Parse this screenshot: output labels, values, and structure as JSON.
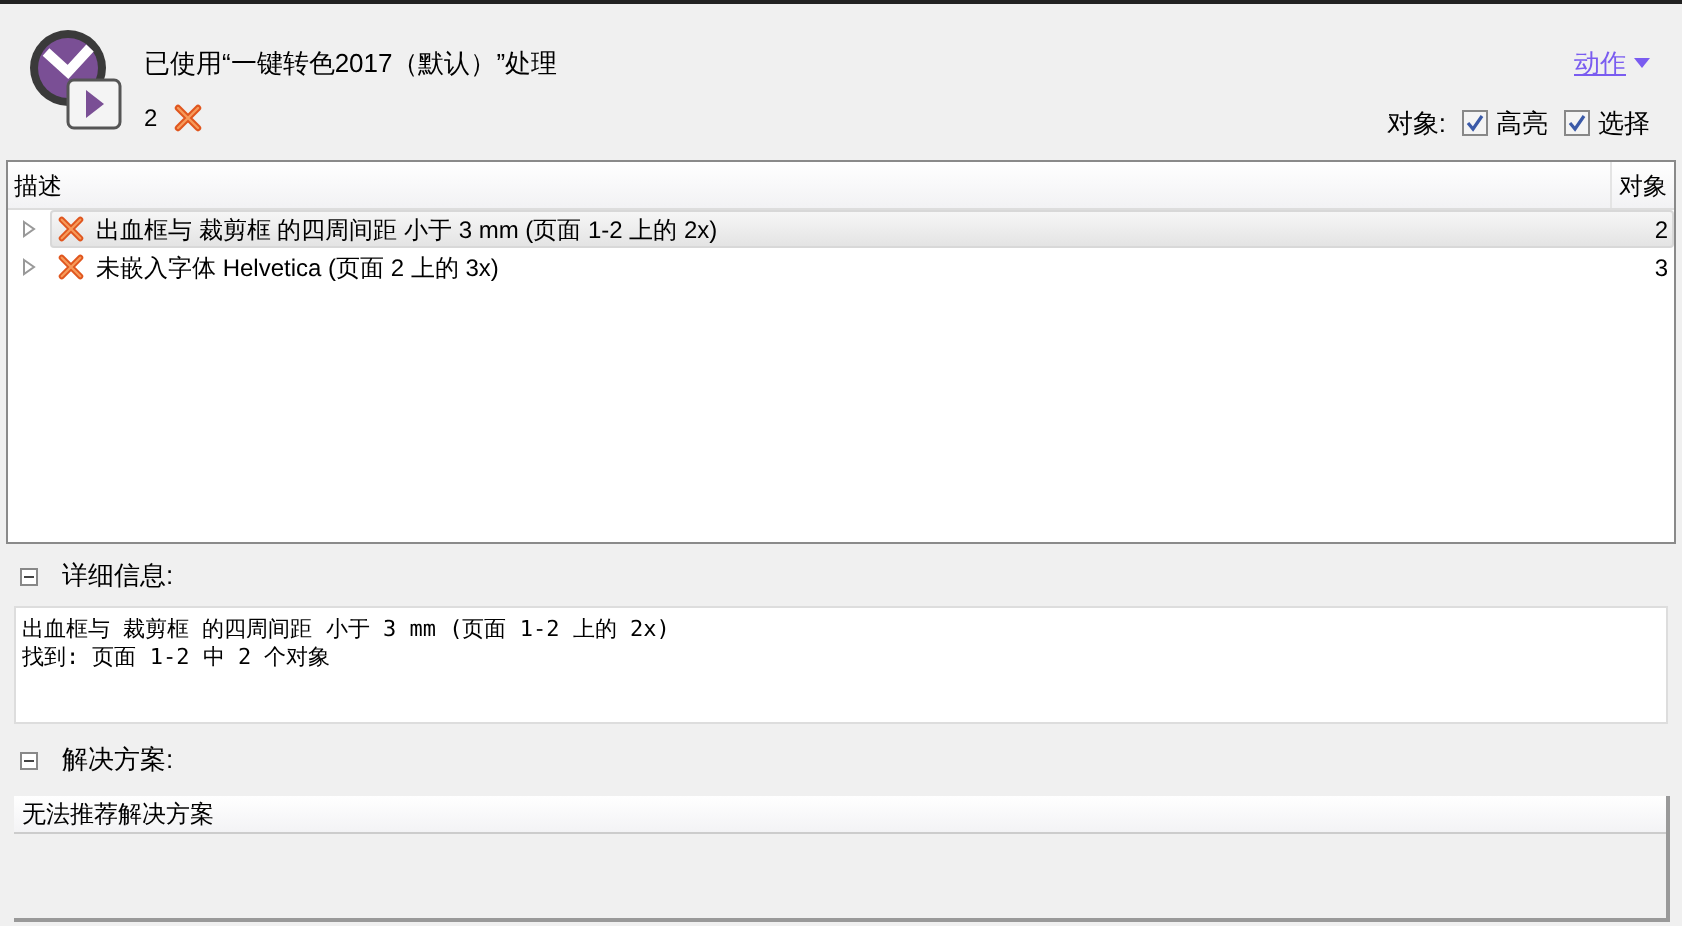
{
  "header": {
    "title": "已使用“一键转色2017（默认）”处理",
    "error_count": "2",
    "action_menu": "动作"
  },
  "object_options": {
    "label": "对象:",
    "checkboxes": [
      {
        "label": "高亮",
        "checked": true
      },
      {
        "label": "选择",
        "checked": true
      }
    ]
  },
  "table": {
    "columns": [
      "描述",
      "对象"
    ],
    "rows": [
      {
        "description": "出血框与 裁剪框 的四周间距 小于 3 mm (页面 1-2 上的 2x)",
        "count": "2",
        "selected": true,
        "expanded": false
      },
      {
        "description": "未嵌入字体 Helvetica (页面 2 上的 3x)",
        "count": "3",
        "selected": false,
        "expanded": false
      }
    ]
  },
  "details": {
    "title": "详细信息:",
    "expanded": true,
    "lines": [
      "出血框与 裁剪框 的四周间距 小于 3 mm (页面 1-2 上的 2x)",
      "找到: 页面 1-2 中 2 个对象"
    ]
  },
  "solutions": {
    "title": "解决方案:",
    "expanded": true,
    "items": [
      "无法推荐解决方案"
    ]
  }
}
